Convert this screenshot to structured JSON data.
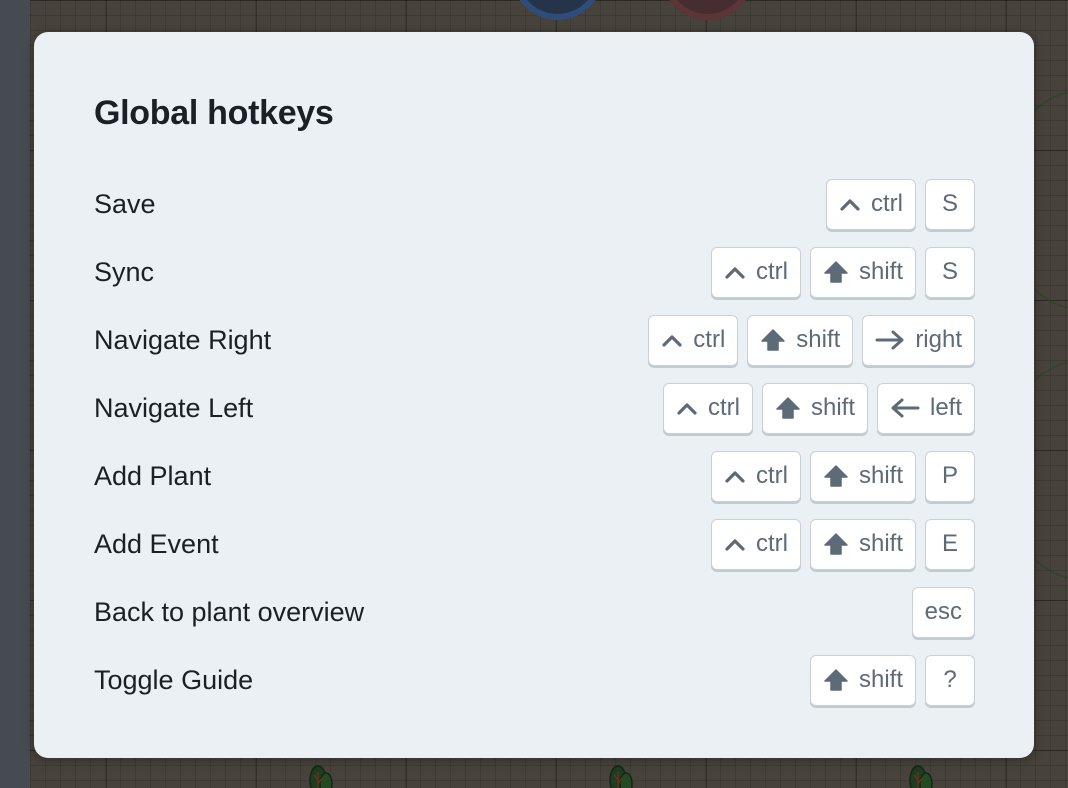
{
  "modal": {
    "title": "Global hotkeys",
    "hotkeys": [
      {
        "label": "Save",
        "keys": [
          {
            "icon": "caret-up-icon",
            "label": "ctrl"
          },
          {
            "icon": null,
            "label": "S"
          }
        ]
      },
      {
        "label": "Sync",
        "keys": [
          {
            "icon": "caret-up-icon",
            "label": "ctrl"
          },
          {
            "icon": "shift-arrow-icon",
            "label": "shift"
          },
          {
            "icon": null,
            "label": "S"
          }
        ]
      },
      {
        "label": "Navigate Right",
        "keys": [
          {
            "icon": "caret-up-icon",
            "label": "ctrl"
          },
          {
            "icon": "shift-arrow-icon",
            "label": "shift"
          },
          {
            "icon": "arrow-right-icon",
            "label": "right"
          }
        ]
      },
      {
        "label": "Navigate Left",
        "keys": [
          {
            "icon": "caret-up-icon",
            "label": "ctrl"
          },
          {
            "icon": "shift-arrow-icon",
            "label": "shift"
          },
          {
            "icon": "arrow-left-icon",
            "label": "left"
          }
        ]
      },
      {
        "label": "Add Plant",
        "keys": [
          {
            "icon": "caret-up-icon",
            "label": "ctrl"
          },
          {
            "icon": "shift-arrow-icon",
            "label": "shift"
          },
          {
            "icon": null,
            "label": "P"
          }
        ]
      },
      {
        "label": "Add Event",
        "keys": [
          {
            "icon": "caret-up-icon",
            "label": "ctrl"
          },
          {
            "icon": "shift-arrow-icon",
            "label": "shift"
          },
          {
            "icon": null,
            "label": "E"
          }
        ]
      },
      {
        "label": "Back to plant overview",
        "keys": [
          {
            "icon": null,
            "label": "esc"
          }
        ]
      },
      {
        "label": "Toggle Guide",
        "keys": [
          {
            "icon": "shift-arrow-icon",
            "label": "shift"
          },
          {
            "icon": null,
            "label": "?"
          }
        ]
      }
    ]
  }
}
